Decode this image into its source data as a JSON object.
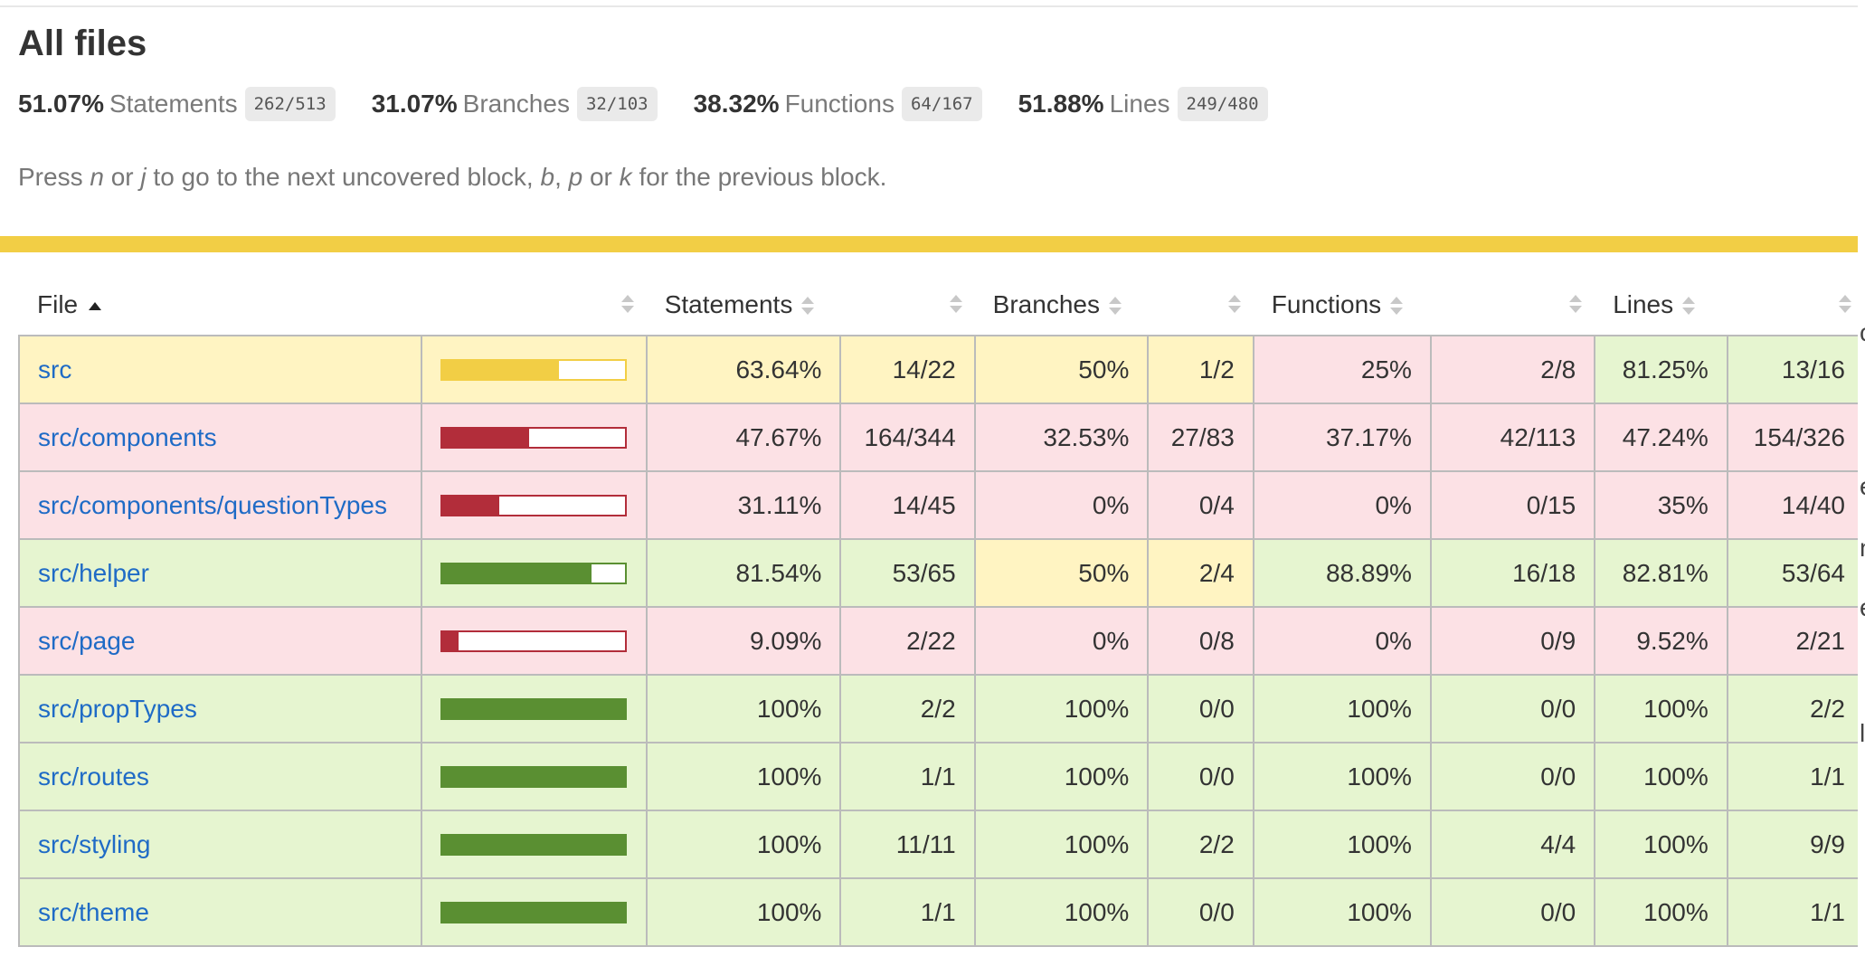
{
  "title": "All files",
  "summary": [
    {
      "pct": "51.07%",
      "label": "Statements",
      "frac": "262/513"
    },
    {
      "pct": "31.07%",
      "label": "Branches",
      "frac": "32/103"
    },
    {
      "pct": "38.32%",
      "label": "Functions",
      "frac": "64/167"
    },
    {
      "pct": "51.88%",
      "label": "Lines",
      "frac": "249/480"
    }
  ],
  "hint": {
    "p1": "Press ",
    "k1": "n",
    "p2": " or ",
    "k2": "j",
    "p3": " to go to the next uncovered block, ",
    "k3": "b",
    "p4": ", ",
    "k4": "p",
    "p5": " or ",
    "k5": "k",
    "p6": " for the previous block."
  },
  "right_edge_fragments": [
    "c",
    "e",
    "n",
    "e",
    "l"
  ],
  "colors": {
    "medium_fill": "#f2ce45",
    "medium_bg": "#fff4c2",
    "low_fill": "#b22d3a",
    "low_bg": "#fce1e5",
    "high_fill": "#5a8f32",
    "high_bg": "#e6f5d0",
    "link": "#1f6bc6",
    "band": "#f2ce45"
  },
  "table": {
    "headers": {
      "file": "File",
      "statements": "Statements",
      "branches": "Branches",
      "functions": "Functions",
      "lines": "Lines"
    },
    "rows": [
      {
        "file": "src",
        "coverage": 0.6364,
        "bar_level": "medium",
        "s_pct": "63.64%",
        "s_frac": "14/22",
        "s_lvl": "medium",
        "b_pct": "50%",
        "b_frac": "1/2",
        "b_lvl": "medium",
        "f_pct": "25%",
        "f_frac": "2/8",
        "f_lvl": "low",
        "l_pct": "81.25%",
        "l_frac": "13/16",
        "l_lvl": "high"
      },
      {
        "file": "src/components",
        "coverage": 0.4767,
        "bar_level": "low",
        "s_pct": "47.67%",
        "s_frac": "164/344",
        "s_lvl": "low",
        "b_pct": "32.53%",
        "b_frac": "27/83",
        "b_lvl": "low",
        "f_pct": "37.17%",
        "f_frac": "42/113",
        "f_lvl": "low",
        "l_pct": "47.24%",
        "l_frac": "154/326",
        "l_lvl": "low"
      },
      {
        "file": "src/components/questionTypes",
        "coverage": 0.3111,
        "bar_level": "low",
        "s_pct": "31.11%",
        "s_frac": "14/45",
        "s_lvl": "low",
        "b_pct": "0%",
        "b_frac": "0/4",
        "b_lvl": "low",
        "f_pct": "0%",
        "f_frac": "0/15",
        "f_lvl": "low",
        "l_pct": "35%",
        "l_frac": "14/40",
        "l_lvl": "low"
      },
      {
        "file": "src/helper",
        "coverage": 0.8154,
        "bar_level": "high",
        "s_pct": "81.54%",
        "s_frac": "53/65",
        "s_lvl": "high",
        "b_pct": "50%",
        "b_frac": "2/4",
        "b_lvl": "medium",
        "f_pct": "88.89%",
        "f_frac": "16/18",
        "f_lvl": "high",
        "l_pct": "82.81%",
        "l_frac": "53/64",
        "l_lvl": "high"
      },
      {
        "file": "src/page",
        "coverage": 0.0909,
        "bar_level": "low",
        "s_pct": "9.09%",
        "s_frac": "2/22",
        "s_lvl": "low",
        "b_pct": "0%",
        "b_frac": "0/8",
        "b_lvl": "low",
        "f_pct": "0%",
        "f_frac": "0/9",
        "f_lvl": "low",
        "l_pct": "9.52%",
        "l_frac": "2/21",
        "l_lvl": "low"
      },
      {
        "file": "src/propTypes",
        "coverage": 1.0,
        "bar_level": "high",
        "s_pct": "100%",
        "s_frac": "2/2",
        "s_lvl": "high",
        "b_pct": "100%",
        "b_frac": "0/0",
        "b_lvl": "high",
        "f_pct": "100%",
        "f_frac": "0/0",
        "f_lvl": "high",
        "l_pct": "100%",
        "l_frac": "2/2",
        "l_lvl": "high"
      },
      {
        "file": "src/routes",
        "coverage": 1.0,
        "bar_level": "high",
        "s_pct": "100%",
        "s_frac": "1/1",
        "s_lvl": "high",
        "b_pct": "100%",
        "b_frac": "0/0",
        "b_lvl": "high",
        "f_pct": "100%",
        "f_frac": "0/0",
        "f_lvl": "high",
        "l_pct": "100%",
        "l_frac": "1/1",
        "l_lvl": "high"
      },
      {
        "file": "src/styling",
        "coverage": 1.0,
        "bar_level": "high",
        "s_pct": "100%",
        "s_frac": "11/11",
        "s_lvl": "high",
        "b_pct": "100%",
        "b_frac": "2/2",
        "b_lvl": "high",
        "f_pct": "100%",
        "f_frac": "4/4",
        "f_lvl": "high",
        "l_pct": "100%",
        "l_frac": "9/9",
        "l_lvl": "high"
      },
      {
        "file": "src/theme",
        "coverage": 1.0,
        "bar_level": "high",
        "s_pct": "100%",
        "s_frac": "1/1",
        "s_lvl": "high",
        "b_pct": "100%",
        "b_frac": "0/0",
        "b_lvl": "high",
        "f_pct": "100%",
        "f_frac": "0/0",
        "f_lvl": "high",
        "l_pct": "100%",
        "l_frac": "1/1",
        "l_lvl": "high"
      }
    ]
  }
}
